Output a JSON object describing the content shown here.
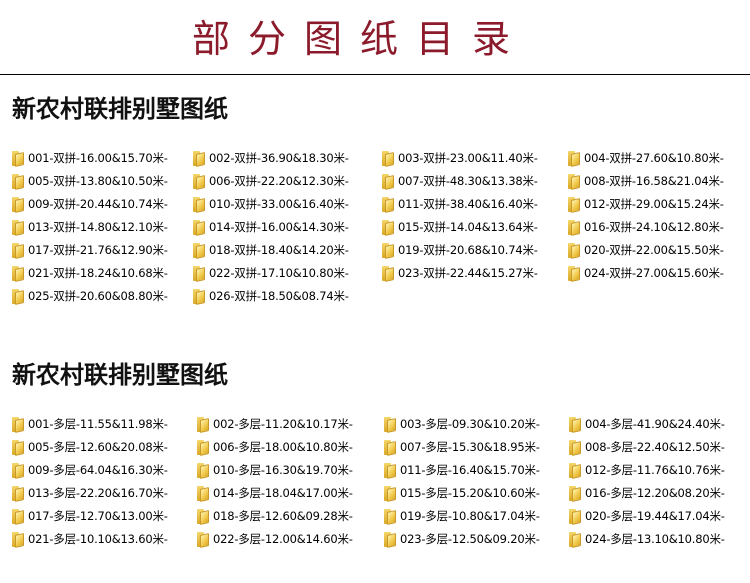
{
  "title": "部分图纸目录",
  "sections": [
    {
      "heading": "新农村联排别墅图纸",
      "items": [
        "001-双拼-16.00&15.70米-",
        "002-双拼-36.90&18.30米-",
        "003-双拼-23.00&11.40米-",
        "004-双拼-27.60&10.80米-",
        "005-双拼-13.80&10.50米-",
        "006-双拼-22.20&12.30米-",
        "007-双拼-48.30&13.38米-",
        "008-双拼-16.58&21.04米-",
        "009-双拼-20.44&10.74米-",
        "010-双拼-33.00&16.40米-",
        "011-双拼-38.40&16.40米-",
        "012-双拼-29.00&15.24米-",
        "013-双拼-14.80&12.10米-",
        "014-双拼-16.00&14.30米-",
        "015-双拼-14.04&13.64米-",
        "016-双拼-24.10&12.80米-",
        "017-双拼-21.76&12.90米-",
        "018-双拼-18.40&14.20米-",
        "019-双拼-20.68&10.74米-",
        "020-双拼-22.00&15.50米-",
        "021-双拼-18.24&10.68米-",
        "022-双拼-17.10&10.80米-",
        "023-双拼-22.44&15.27米-",
        "024-双拼-27.00&15.60米-",
        "025-双拼-20.60&08.80米-",
        "026-双拼-18.50&08.74米-"
      ]
    },
    {
      "heading": "新农村联排别墅图纸",
      "items": [
        "001-多层-11.55&11.98米-",
        "002-多层-11.20&10.17米-",
        "003-多层-09.30&10.20米-",
        "004-多层-41.90&24.40米-",
        "005-多层-12.60&20.08米-",
        "006-多层-18.00&10.80米-",
        "007-多层-15.30&18.95米-",
        "008-多层-22.40&12.50米-",
        "009-多层-64.04&16.30米-",
        "010-多层-16.30&19.70米-",
        "011-多层-16.40&15.70米-",
        "012-多层-11.76&10.76米-",
        "013-多层-22.20&16.70米-",
        "014-多层-18.04&17.00米-",
        "015-多层-15.20&10.60米-",
        "016-多层-12.20&08.20米-",
        "017-多层-12.70&13.00米-",
        "018-多层-12.60&09.28米-",
        "019-多层-10.80&17.04米-",
        "020-多层-19.44&17.04米-",
        "021-多层-10.10&13.60米-",
        "022-多层-12.00&14.60米-",
        "023-多层-12.50&09.20米-",
        "024-多层-13.10&10.80米-"
      ]
    }
  ]
}
